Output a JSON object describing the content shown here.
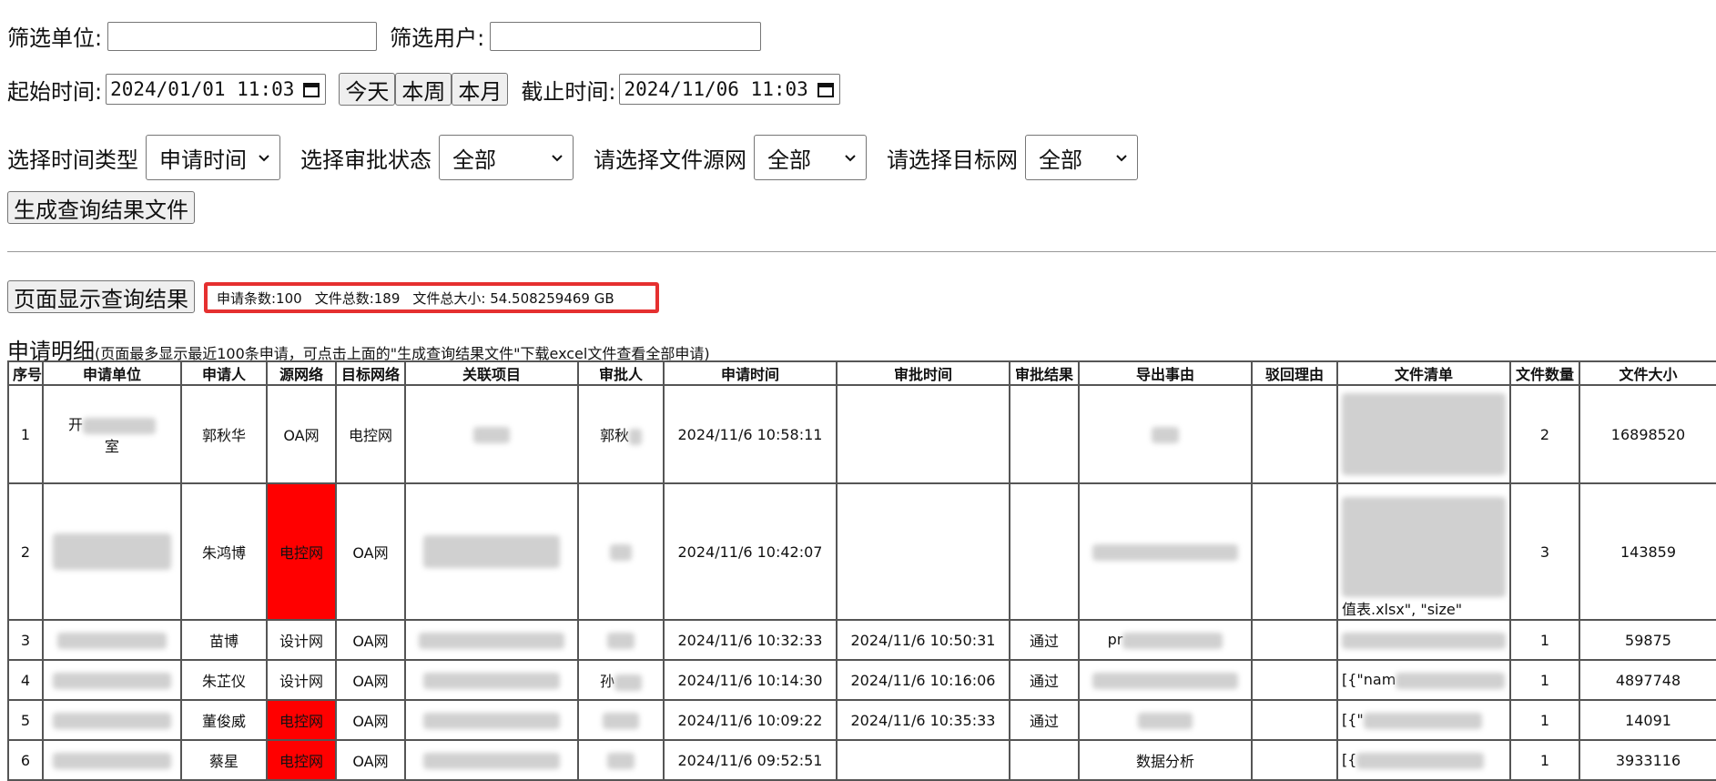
{
  "filters": {
    "unit_label": "筛选单位:",
    "user_label": "筛选用户:",
    "start_label": "起始时间:",
    "start_value": "2024/01/01  11:03",
    "end_label": "截止时间:",
    "end_value": "2024/11/06  11:03",
    "today_button": "今天",
    "week_button": "本周",
    "month_button": "本月",
    "time_type_label": "选择时间类型",
    "time_type_value": "申请时间",
    "approval_status_label": "选择审批状态",
    "approval_status_value": "全部",
    "source_net_label": "请选择文件源网",
    "source_net_value": "全部",
    "target_net_label": "请选择目标网",
    "target_net_value": "全部",
    "generate_button": "生成查询结果文件"
  },
  "results": {
    "show_button": "页面显示查询结果",
    "count": "申请条数:100",
    "file_total": "文件总数:189",
    "size_total": "文件总大小: 54.508259469 GB"
  },
  "table": {
    "title": "申请明细",
    "note": "(页面最多显示最近100条申请，可点击上面的\"生成查询结果文件\"下载excel文件查看全部申请)",
    "columns": [
      "序号",
      "申请单位",
      "申请人",
      "源网络",
      "目标网络",
      "关联项目",
      "审批人",
      "申请时间",
      "审批时间",
      "审批结果",
      "导出事由",
      "驳回理由",
      "文件清单",
      "文件数量",
      "文件大小"
    ],
    "rows": [
      {
        "no": "1",
        "unit": "开",
        "unit2": "室",
        "user": "郭秋华",
        "src": "OA网",
        "src_red": false,
        "dst": "电控网",
        "project": "",
        "approver": "郭秋",
        "apply_time": "2024/11/6 10:58:11",
        "approve_time": "",
        "result": "",
        "reason": "",
        "reject": "",
        "files": "",
        "count": "2",
        "size": "16898520"
      },
      {
        "no": "2",
        "unit": "",
        "unit2": "",
        "user": "朱鸿博",
        "src": "电控网",
        "src_red": true,
        "dst": "OA网",
        "project": "",
        "approver": "",
        "apply_time": "2024/11/6 10:42:07",
        "approve_time": "",
        "result": "",
        "reason": "",
        "reject": "",
        "files": "值表.xlsx\", \"size\"",
        "count": "3",
        "size": "143859"
      },
      {
        "no": "3",
        "unit": "",
        "unit2": "",
        "user": "苗博",
        "src": "设计网",
        "src_red": false,
        "dst": "OA网",
        "project": "",
        "approver": "",
        "apply_time": "2024/11/6 10:32:33",
        "approve_time": "2024/11/6 10:50:31",
        "result": "通过",
        "reason": "pr",
        "reject": "",
        "files": "",
        "count": "1",
        "size": "59875"
      },
      {
        "no": "4",
        "unit": "",
        "unit2": "",
        "user": "朱芷仪",
        "src": "设计网",
        "src_red": false,
        "dst": "OA网",
        "project": "",
        "approver": "孙",
        "apply_time": "2024/11/6 10:14:30",
        "approve_time": "2024/11/6 10:16:06",
        "result": "通过",
        "reason": "",
        "reject": "",
        "files": "[{\"nam",
        "count": "1",
        "size": "4897748"
      },
      {
        "no": "5",
        "unit": "",
        "unit2": "",
        "user": "董俊威",
        "src": "电控网",
        "src_red": true,
        "dst": "OA网",
        "project": "",
        "approver": "",
        "apply_time": "2024/11/6 10:09:22",
        "approve_time": "2024/11/6 10:35:33",
        "result": "通过",
        "reason": "",
        "reject": "",
        "files": "[{\"",
        "count": "1",
        "size": "14091"
      },
      {
        "no": "6",
        "unit": "",
        "unit2": "",
        "user": "蔡星",
        "src": "电控网",
        "src_red": true,
        "dst": "OA网",
        "project": "",
        "approver": "",
        "apply_time": "2024/11/6 09:52:51",
        "approve_time": "",
        "result": "",
        "reason": "数据分析",
        "reject": "",
        "files": "[{",
        "count": "1",
        "size": "3933116"
      }
    ]
  },
  "colors": {
    "highlight_red": "#ff0000",
    "box_border": "#e53030"
  }
}
